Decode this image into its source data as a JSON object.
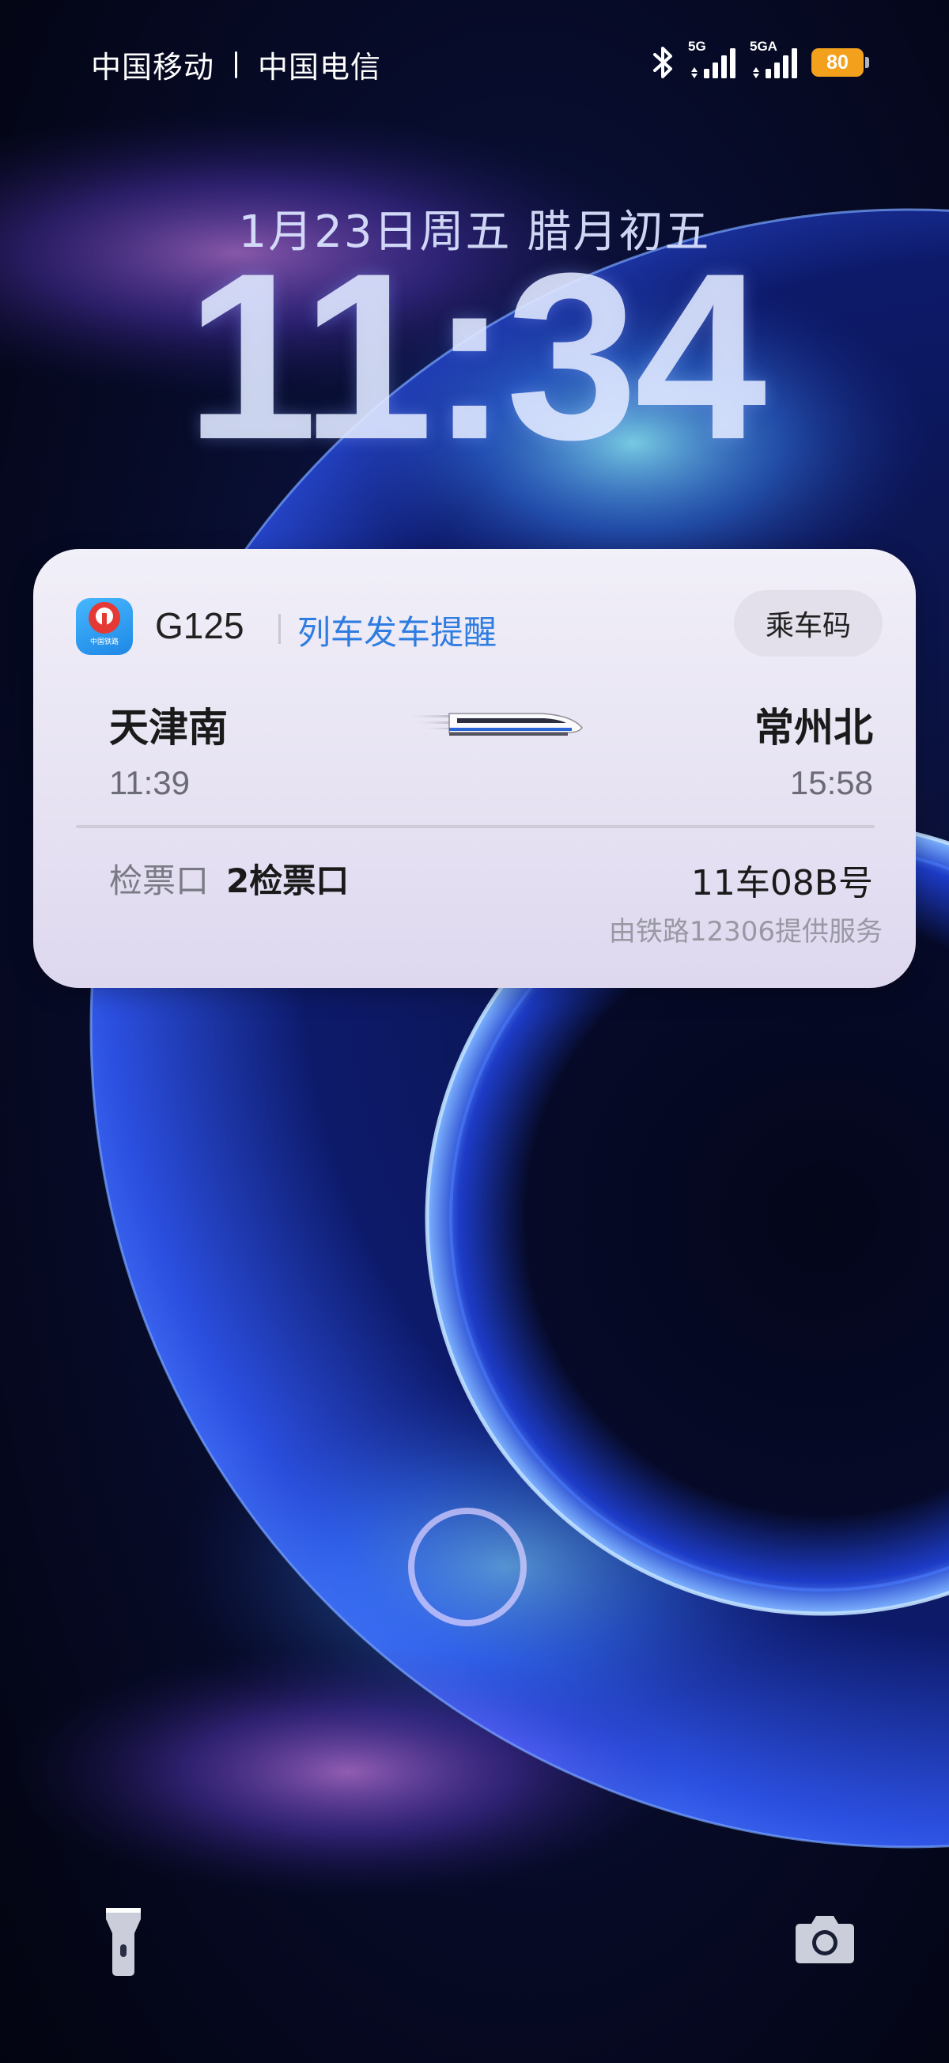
{
  "status_bar": {
    "carrier_1": "中国移动",
    "carrier_2": "中国电信",
    "network_1": "5G",
    "network_2": "5GA",
    "battery_level": "80",
    "battery_color": "#f3a11d",
    "icons": [
      "bluetooth-icon",
      "signal-icon",
      "signal-icon",
      "battery-icon"
    ]
  },
  "lock_screen": {
    "date": "1月23日周五 腊月初五",
    "time": "11:34"
  },
  "notification": {
    "app_icon": "china-railway-12306-icon",
    "app_icon_caption": "中国铁路",
    "train_number": "G125",
    "title": "列车发车提醒",
    "ticket_button": "乘车码",
    "from_station": "天津南",
    "to_station": "常州北",
    "depart_time": "11:39",
    "arrive_time": "15:58",
    "gate_label": "检票口",
    "gate_value": "2检票口",
    "seat": "11车08B号",
    "provider": "由铁路12306提供服务",
    "accent_color": "#2f7de1"
  },
  "shortcuts": {
    "left": "flashlight-icon",
    "right": "camera-icon"
  }
}
